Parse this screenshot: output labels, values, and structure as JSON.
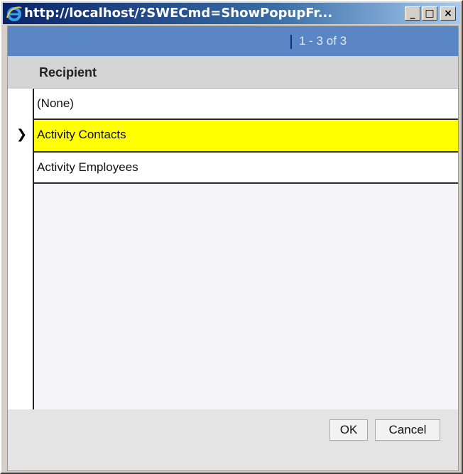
{
  "window": {
    "title": "http://localhost/?SWECmd=ShowPopupFr...",
    "controls": {
      "minimize": "_",
      "maximize": "□",
      "close": "×"
    }
  },
  "toolbar": {
    "record_count": "1 - 3 of 3"
  },
  "grid": {
    "column_header": "Recipient",
    "rows": [
      "(None)",
      "Activity Contacts",
      "Activity Employees"
    ],
    "selected_index": 1,
    "selection_color": "#ffff00"
  },
  "buttons": {
    "ok": "OK",
    "cancel": "Cancel"
  },
  "colors": {
    "toolbar": "#5b86c5",
    "titlebar": "#0a246a"
  }
}
